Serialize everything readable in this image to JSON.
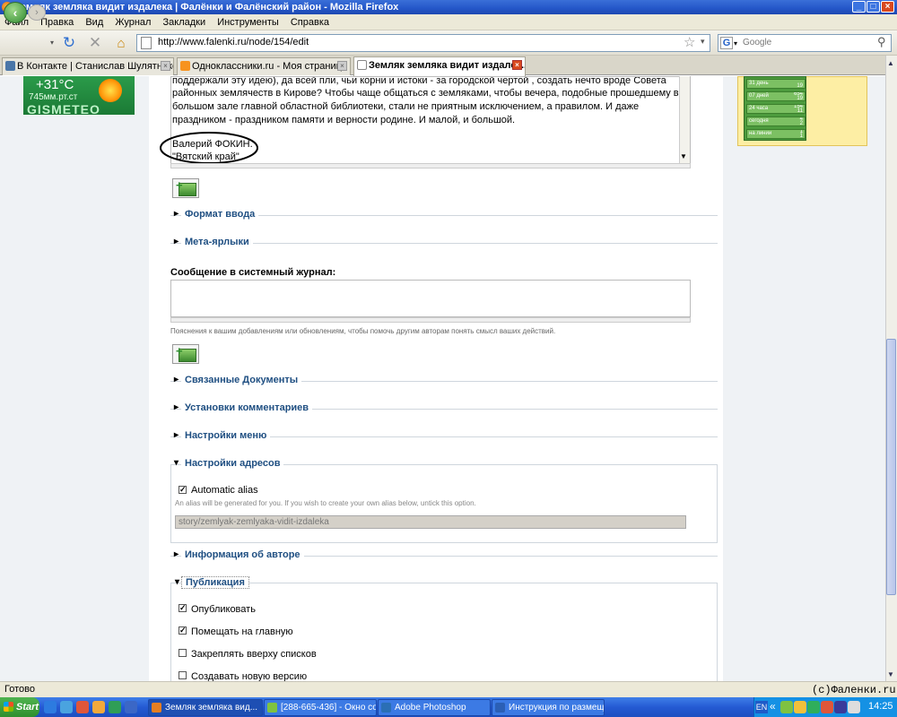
{
  "window": {
    "title": "Земляк земляка видит издалека | Фалёнки и Фалёнский район - Mozilla Firefox",
    "minimize": "_",
    "maximize": "□",
    "close": "×"
  },
  "menu": [
    "Файл",
    "Правка",
    "Вид",
    "Журнал",
    "Закладки",
    "Инструменты",
    "Справка"
  ],
  "nav": {
    "url": "http://www.falenki.ru/node/154/edit",
    "search_placeholder": "Google",
    "back_icon": "back-arrow-icon",
    "forward_icon": "forward-arrow-icon"
  },
  "tabs": [
    {
      "label": "В Контакте | Станислав Шулятников",
      "icon_color": "#4a76a8"
    },
    {
      "label": "Одноклассники.ru - Моя страница",
      "icon_color": "#f7931e"
    },
    {
      "label": "Земляк земляка видит издалек...",
      "icon_color": "#ffffff",
      "active": true
    }
  ],
  "weather": {
    "temp": "+31°C",
    "pressure": "745мм.рт.ст",
    "logo": "GISMETEO"
  },
  "stats": [
    {
      "label": "31 день",
      "a": "",
      "b": "19"
    },
    {
      "label": "07 дней",
      "a": "654",
      "b": "19"
    },
    {
      "label": "24 часа",
      "a": "154",
      "b": "11"
    },
    {
      "label": "сегодня",
      "a": "4",
      "b": "2"
    },
    {
      "label": "на линии",
      "a": "1",
      "b": "1"
    }
  ],
  "body": {
    "line1": "поддержали эту идею), да всей пли, чьи корни и истоки - за городской чертой , создать нечто вроде Совета",
    "line2": "районных землячеств в Кирове? Чтобы чаще общаться с земляками, чтобы вечера, подобные прошедшему в",
    "line3": "большом зале главной областной библиотеки, стали не приятным исключением, а правилом. И даже",
    "line4": "праздником - праздником памяти и верности родине. И малой, и большой.",
    "author": "Валерий ФОКИН.",
    "source": "\"Вятский край\""
  },
  "sections": {
    "input_format": "Формат ввода",
    "meta_tags": "Мета-ярлыки",
    "log_label": "Сообщение в системный журнал:",
    "log_hint": "Пояснения к вашим добавлениям или обновлениям, чтобы помочь другим авторам понять смысл ваших действий.",
    "related_docs": "Связанные Документы",
    "comment_settings": "Установки комментариев",
    "menu_settings": "Настройки меню",
    "address_settings": "Настройки адресов",
    "automatic_alias": "Automatic alias",
    "alias_desc": "An alias will be generated for you. If you wish to create your own alias below, untick this option.",
    "alias_value": "story/zemlyak-zemlyaka-vidit-izdaleka",
    "author_info": "Информация об авторе",
    "publication": "Публикация",
    "publish": "Опубликовать",
    "promote": "Помещать на главную",
    "sticky": "Закреплять вверху списков",
    "new_revision": "Создавать новую версию"
  },
  "status": {
    "text": "Готово",
    "copyright": "(c)Фаленки.ru"
  },
  "taskbar": {
    "start": "Start",
    "items": [
      {
        "label": "Земляк земляка вид...",
        "icon_color": "#e67e22",
        "active": true
      },
      {
        "label": "[288-665-436] - Окно со...",
        "icon_color": "#7fc241"
      },
      {
        "label": "Adobe Photoshop",
        "icon_color": "#2b6fb5"
      },
      {
        "label": "Инструкция по размещ...",
        "icon_color": "#2b5fb5"
      }
    ],
    "lang": "EN",
    "clock": "14:25"
  }
}
